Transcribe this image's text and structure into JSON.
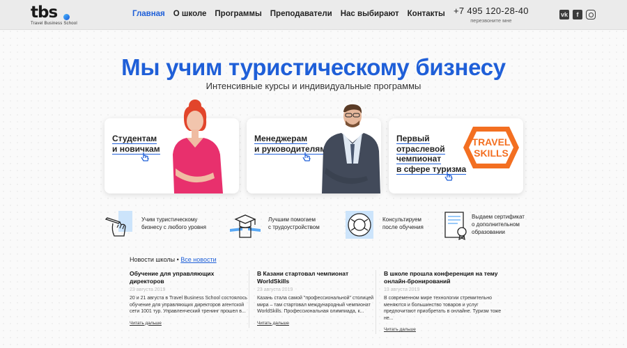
{
  "header": {
    "logo_text": "tbs",
    "logo_subtitle": "Travel Business School",
    "nav": [
      {
        "label": "Главная",
        "active": true
      },
      {
        "label": "О школе",
        "active": false
      },
      {
        "label": "Программы",
        "active": false
      },
      {
        "label": "Преподаватели",
        "active": false
      },
      {
        "label": "Нас выбирают",
        "active": false
      },
      {
        "label": "Контакты",
        "active": false
      }
    ],
    "phone": "+7 495 120-28-40",
    "callback": "перезвоните мне",
    "social": {
      "vk": "vk",
      "fb": "f"
    }
  },
  "hero": {
    "title": "Мы учим туристическому бизнесу",
    "subtitle": "Интенсивные курсы и индивидуальные программы"
  },
  "cards": [
    {
      "label": "Студентам\nи новичкам"
    },
    {
      "label": "Менеджерам\nи руководителям"
    },
    {
      "label": "Первый\nотраслевой\nчемпионат\nв сфере туризма",
      "badge_line1": "TRAVEL",
      "badge_line2": "SKILLS"
    }
  ],
  "features": [
    {
      "text": "Учим туристическому\nбизнесу с любого уровня",
      "icon": "hand-pencil-icon"
    },
    {
      "text": "Лучшим помогаем\nс трудоустройством",
      "icon": "graduation-cap-icon"
    },
    {
      "text": "Консультируем\nпосле обучения",
      "icon": "lifebuoy-icon"
    },
    {
      "text": "Выдаем сертификат\nо дополнительном\nобразовании",
      "icon": "certificate-icon"
    }
  ],
  "news": {
    "heading": "Новости школы",
    "separator": " • ",
    "all_link": "Все новости",
    "items": [
      {
        "title": "Обучение для управляющих директоров",
        "date": "23 августа 2019",
        "text": "20 и 21 августа в Travel Business School состоялось обучение для управляющих директоров агентской сети 1001 тур. Управленческий тренинг прошел в...",
        "more": "Читать дальше"
      },
      {
        "title": "В Казани стартовал чемпионат WorldSkills",
        "date": "23 августа 2019",
        "text": "Казань стала самой \"профессиональной\" столицей мира – там стартовал международный чемпионат WorldSkills. Профессиональная олимпиада, к...",
        "more": "Читать дальше"
      },
      {
        "title": "В школе прошла конференция на тему онлайн-бронирований",
        "date": "13 августа 2019",
        "text": "В современном мире технологии стремительно меняются и большинство товаров и услуг предпочитают приобретать в онлайне. Туризм тоже не...",
        "more": "Читать дальше"
      }
    ]
  },
  "colors": {
    "accent": "#1f5fd8",
    "badge": "#f36f21"
  }
}
